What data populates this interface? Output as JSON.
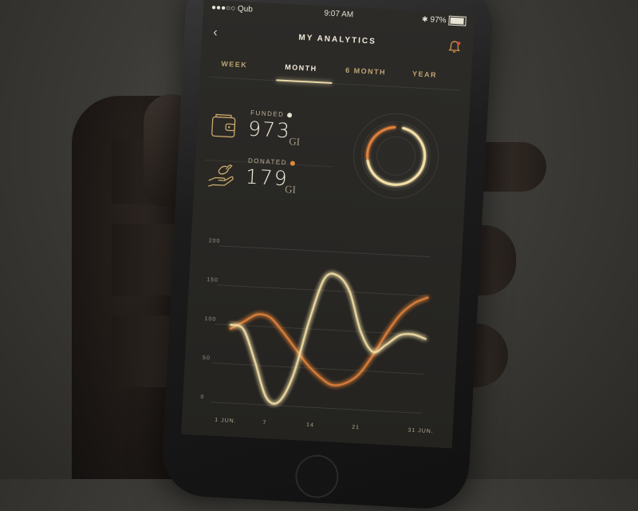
{
  "status_bar": {
    "carrier": "●●●○○ Qub",
    "time": "9:07 AM",
    "battery": "97%"
  },
  "header": {
    "title": "MY ANALYTICS"
  },
  "tabs": [
    {
      "label": "WEEK",
      "active": false
    },
    {
      "label": "MONTH",
      "active": true
    },
    {
      "label": "6 MONTH",
      "active": false
    },
    {
      "label": "YEAR",
      "active": false
    }
  ],
  "stats": {
    "funded": {
      "label": "FUNDED",
      "value": "973",
      "unit": "GI",
      "dot_color": "#e9e3d3"
    },
    "donated": {
      "label": "DONATED",
      "value": "179",
      "unit": "GI",
      "dot_color": "#e08a3c"
    }
  },
  "ring_share": {
    "funded": 0.72,
    "donated": 0.28
  },
  "colors": {
    "accent_gold": "#f3dfa6",
    "accent_orange": "#e0813a",
    "muted_gold": "#bfa473"
  },
  "chart_data": {
    "type": "line",
    "y_ticks": [
      "0",
      "50",
      "100",
      "150",
      "200"
    ],
    "x_ticks": [
      "1 JUN.",
      "7",
      "14",
      "21",
      "31 JUN."
    ],
    "ylim": [
      0,
      200
    ],
    "xlim": [
      1,
      31
    ],
    "series": [
      {
        "x": [
          1,
          3,
          5,
          7,
          9,
          11,
          13,
          15,
          17,
          19,
          21,
          23,
          25,
          27,
          29,
          31
        ],
        "values": [
          100,
          95,
          55,
          10,
          5,
          40,
          110,
          165,
          170,
          150,
          100,
          75,
          85,
          98,
          100,
          95
        ]
      },
      {
        "x": [
          1,
          3,
          5,
          7,
          9,
          11,
          13,
          15,
          17,
          19,
          21,
          23,
          25,
          27,
          29,
          31
        ],
        "values": [
          95,
          105,
          115,
          112,
          95,
          75,
          55,
          40,
          30,
          33,
          45,
          70,
          100,
          125,
          140,
          148
        ]
      }
    ]
  }
}
